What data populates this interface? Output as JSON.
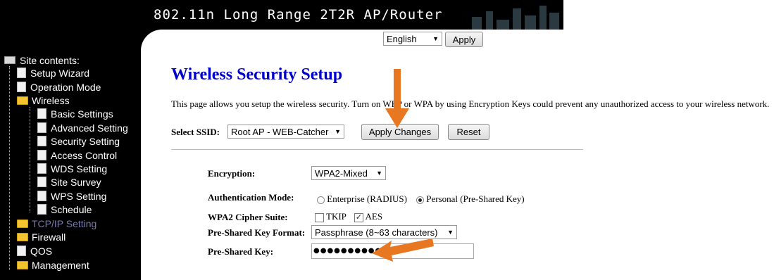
{
  "header": {
    "banner_title": "802.11n Long Range 2T2R AP/Router"
  },
  "language": {
    "selected": "English",
    "apply_label": "Apply"
  },
  "sidebar": {
    "root_label": "Site contents:",
    "items": [
      {
        "label": "Setup Wizard",
        "icon": "document-icon"
      },
      {
        "label": "Operation Mode",
        "icon": "document-icon"
      },
      {
        "label": "Wireless",
        "icon": "folder-open-icon"
      },
      {
        "label": "Basic Settings",
        "icon": "document-icon"
      },
      {
        "label": "Advanced Setting",
        "icon": "document-icon"
      },
      {
        "label": "Security Setting",
        "icon": "document-icon"
      },
      {
        "label": "Access Control",
        "icon": "document-icon"
      },
      {
        "label": "WDS Setting",
        "icon": "document-icon"
      },
      {
        "label": "Site Survey",
        "icon": "document-icon"
      },
      {
        "label": "WPS Setting",
        "icon": "document-icon"
      },
      {
        "label": "Schedule",
        "icon": "document-icon"
      },
      {
        "label": "TCP/IP Setting",
        "icon": "folder-icon"
      },
      {
        "label": "Firewall",
        "icon": "folder-icon"
      },
      {
        "label": "QOS",
        "icon": "document-icon"
      },
      {
        "label": "Management",
        "icon": "folder-icon"
      }
    ]
  },
  "main": {
    "title": "Wireless Security Setup",
    "description": "This page allows you setup the wireless security. Turn on WEP or WPA by using Encryption Keys could prevent any unauthorized access to your wireless network.",
    "ssid_label": "Select SSID:",
    "ssid_value": "Root AP - WEB-Catcher",
    "apply_changes_label": "Apply Changes",
    "reset_label": "Reset",
    "encryption_label": "Encryption:",
    "encryption_value": "WPA2-Mixed",
    "auth_mode_label": "Authentication Mode:",
    "auth_enterprise": "Enterprise (RADIUS)",
    "auth_personal": "Personal (Pre-Shared Key)",
    "cipher_label": "WPA2 Cipher Suite:",
    "cipher_tkip": "TKIP",
    "cipher_aes": "AES",
    "psk_format_label": "Pre-Shared Key Format:",
    "psk_format_value": "Passphrase (8~63 characters)",
    "psk_label": "Pre-Shared Key:",
    "psk_value": "●●●●●●●●●●●"
  },
  "colors": {
    "title": "#0000cc",
    "arrow": "#e87722",
    "active_nav": "#7a7aa8"
  }
}
